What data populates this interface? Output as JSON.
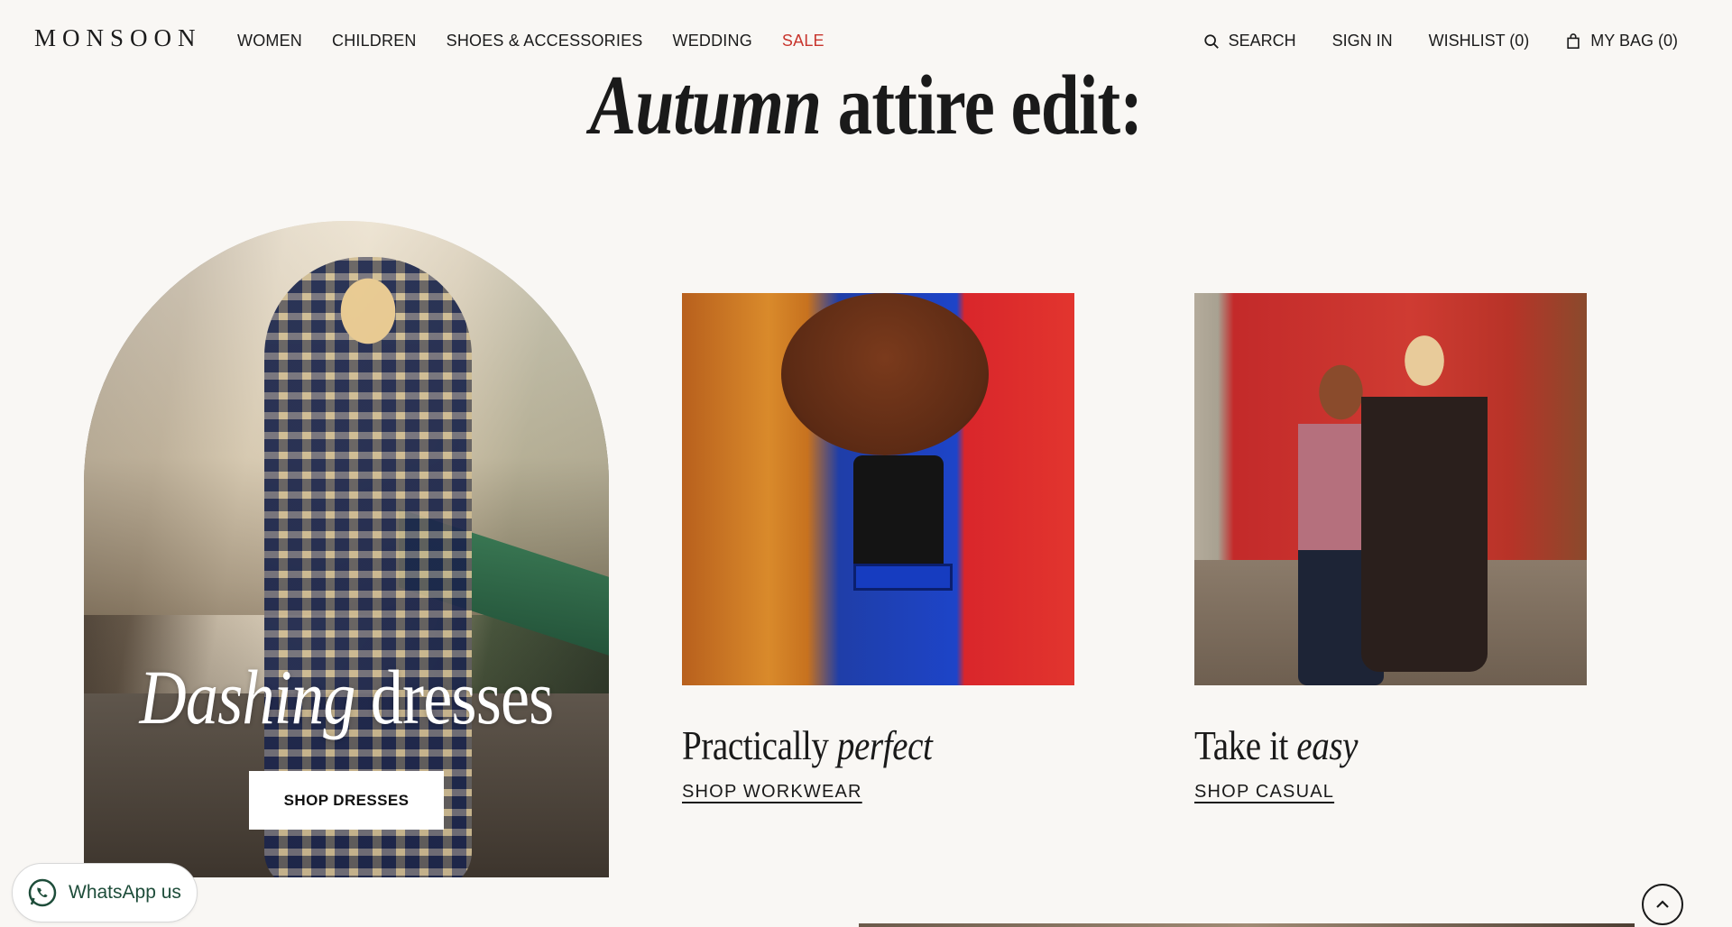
{
  "header": {
    "logo": "MONSOON",
    "nav": [
      {
        "label": "WOMEN"
      },
      {
        "label": "CHILDREN"
      },
      {
        "label": "SHOES & ACCESSORIES"
      },
      {
        "label": "WEDDING"
      },
      {
        "label": "SALE",
        "accent": "#c8352d"
      }
    ],
    "utils": {
      "search": "SEARCH",
      "sign_in": "SIGN IN",
      "wishlist": "WISHLIST (0)",
      "bag": "MY BAG (0)"
    },
    "icons": {
      "search": "search-icon",
      "bag": "shopping-bag-icon"
    }
  },
  "headline": {
    "italic": "Autumn",
    "rest": "attire edit:"
  },
  "cards": {
    "dresses": {
      "title_italic": "Dashing",
      "title_rest": "dresses",
      "button": "SHOP DRESSES"
    },
    "workwear": {
      "title_rest": "Practically",
      "title_italic": "perfect",
      "link": "SHOP WORKWEAR"
    },
    "casual": {
      "title_rest": "Take it",
      "title_italic": "easy",
      "link": "SHOP CASUAL"
    }
  },
  "whatsapp": {
    "label": "WhatsApp us",
    "icon": "whatsapp-icon",
    "color": "#1e4d3a"
  },
  "back_to_top": {
    "icon": "chevron-up-icon"
  },
  "colors": {
    "background": "#f9f7f4",
    "text": "#1a1a1a",
    "sale": "#c8352d"
  }
}
